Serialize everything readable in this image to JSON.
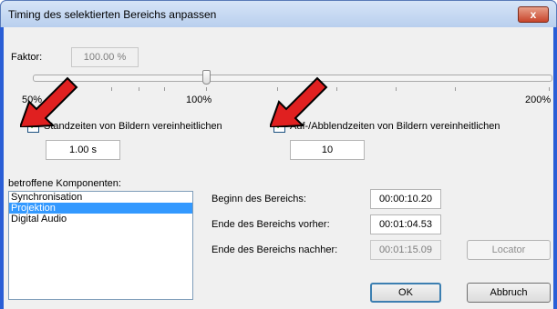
{
  "window": {
    "title": "Timing des selektierten Bereichs anpassen",
    "close_label": "x"
  },
  "factor": {
    "label": "Faktor:",
    "value": "100.00 %"
  },
  "slider": {
    "ticks": [
      "50%",
      "100%",
      "200%"
    ],
    "value_percent": 100
  },
  "standzeiten": {
    "label": "Standzeiten von Bildern vereinheitlichen",
    "checked": true,
    "value": "1.00 s"
  },
  "blendzeiten": {
    "label": "Auf-/Abblendzeiten von Bildern vereinheitlichen",
    "checked": true,
    "value": "10"
  },
  "components": {
    "label": "betroffene Komponenten:",
    "items": [
      "Synchronisation",
      "Projektion",
      "Digital Audio"
    ],
    "selected": "Projektion"
  },
  "range": {
    "begin_label": "Beginn des Bereichs:",
    "begin_value": "00:00:10.20",
    "end_before_label": "Ende des Bereichs vorher:",
    "end_before_value": "00:01:04.53",
    "end_after_label": "Ende des Bereichs nachher:",
    "end_after_value": "00:01:15.09"
  },
  "buttons": {
    "locator": "Locator",
    "ok": "OK",
    "cancel": "Abbruch"
  },
  "colors": {
    "title_bar": "#c7d9f2",
    "selection": "#3399ff",
    "arrow": "#e02020"
  }
}
